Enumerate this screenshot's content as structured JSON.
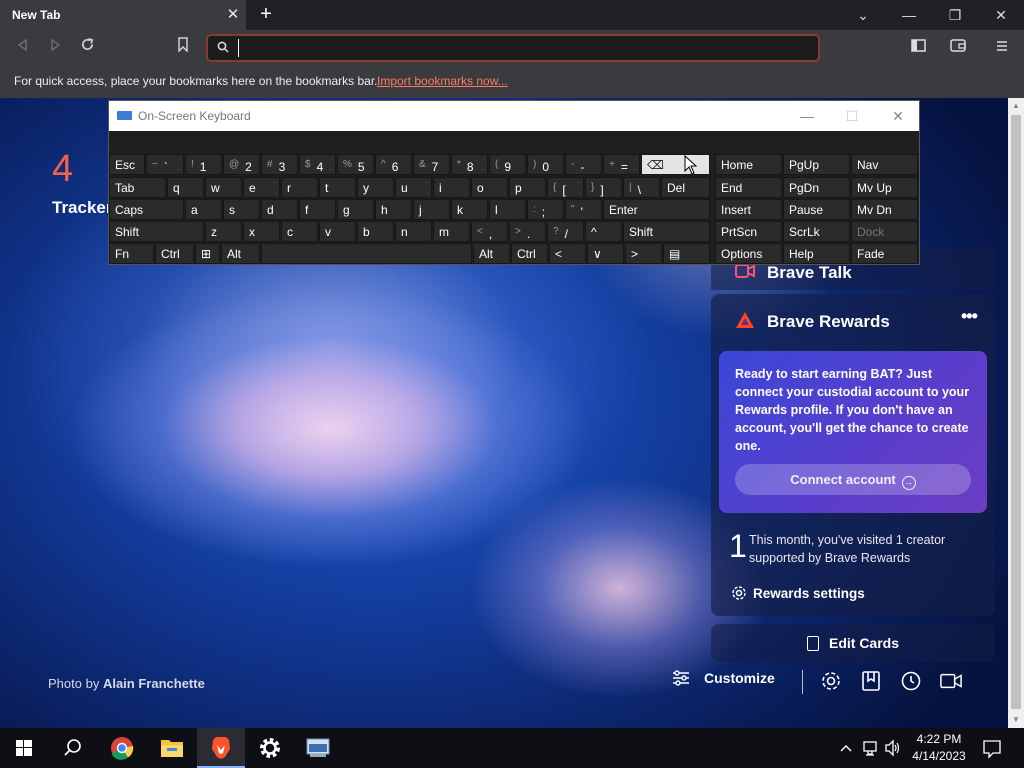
{
  "browser": {
    "tab_title": "New Tab",
    "tab_close_glyph": "✕",
    "new_tab_glyph": "+",
    "window_controls": {
      "list": "⌄",
      "minimize": "—",
      "maximize": "❐",
      "close": "✕"
    },
    "toolbar": {
      "back_icon": "back-arrow-icon",
      "forward_icon": "forward-arrow-icon",
      "reload_icon": "reload-icon",
      "bookmark_icon": "bookmark-icon",
      "address_value": "",
      "address_placeholder": "",
      "sidebar_icon": "sidebar-icon",
      "wallet_icon": "wallet-icon",
      "menu_icon": "menu-icon"
    },
    "bookmarks_bar": {
      "message": "For quick access, place your bookmarks here on the bookmarks bar.",
      "import_link": "Import bookmarks now..."
    }
  },
  "newtab": {
    "trackers_count": "4",
    "trackers_label": "Tracker",
    "photo_credit_prefix": "Photo by",
    "photo_credit_name": "Alain Franchette",
    "brave_talk": {
      "title": "Brave Talk"
    },
    "brave_rewards": {
      "title": "Brave Rewards",
      "more_glyph": "•••",
      "promo_text": "Ready to start earning BAT? Just connect your custodial account to your Rewards profile. If you don't have an account, you'll get the chance to create one.",
      "connect_button": "Connect account",
      "connect_arrow": "→",
      "visit_count": "1",
      "visit_text": "This month, you've visited 1 creator supported by Brave Rewards",
      "settings_label": "Rewards settings"
    },
    "edit_cards_label": "Edit Cards",
    "customize_label": "Customize"
  },
  "osk": {
    "title": "On-Screen Keyboard",
    "controls": {
      "minimize": "—",
      "maximize": "☐",
      "close": "✕"
    },
    "rows": [
      [
        {
          "id": "esc",
          "main": "Esc"
        },
        {
          "id": "tilde",
          "shift": "~",
          "main": "`"
        },
        {
          "id": "k1",
          "shift": "!",
          "main": "1"
        },
        {
          "id": "k2",
          "shift": "@",
          "main": "2"
        },
        {
          "id": "k3",
          "shift": "#",
          "main": "3"
        },
        {
          "id": "k4",
          "shift": "$",
          "main": "4"
        },
        {
          "id": "k5",
          "shift": "%",
          "main": "5"
        },
        {
          "id": "k6",
          "shift": "^",
          "main": "6"
        },
        {
          "id": "k7",
          "shift": "&",
          "main": "7"
        },
        {
          "id": "k8",
          "shift": "*",
          "main": "8"
        },
        {
          "id": "k9",
          "shift": "(",
          "main": "9"
        },
        {
          "id": "k0",
          "shift": ")",
          "main": "0"
        },
        {
          "id": "minus",
          "shift": "-",
          "main": "-"
        },
        {
          "id": "equals",
          "shift": "+",
          "main": "="
        },
        {
          "id": "backspace",
          "main": "⌫"
        },
        {
          "id": "home",
          "main": "Home"
        },
        {
          "id": "pgup",
          "main": "PgUp"
        },
        {
          "id": "nav",
          "main": "Nav"
        }
      ],
      [
        {
          "id": "tab",
          "main": "Tab"
        },
        {
          "id": "q",
          "main": "q"
        },
        {
          "id": "w",
          "main": "w"
        },
        {
          "id": "e",
          "main": "e"
        },
        {
          "id": "r",
          "main": "r"
        },
        {
          "id": "t",
          "main": "t"
        },
        {
          "id": "y",
          "main": "y"
        },
        {
          "id": "u",
          "main": "u"
        },
        {
          "id": "i",
          "main": "i"
        },
        {
          "id": "o",
          "main": "o"
        },
        {
          "id": "p",
          "main": "p"
        },
        {
          "id": "lbracket",
          "shift": "{",
          "main": "["
        },
        {
          "id": "rbracket",
          "shift": "}",
          "main": "]"
        },
        {
          "id": "backslash",
          "shift": "|",
          "main": "\\"
        },
        {
          "id": "del",
          "main": "Del"
        },
        {
          "id": "end",
          "main": "End"
        },
        {
          "id": "pgdn",
          "main": "PgDn"
        },
        {
          "id": "mvup",
          "main": "Mv Up"
        }
      ],
      [
        {
          "id": "caps",
          "main": "Caps"
        },
        {
          "id": "a",
          "main": "a"
        },
        {
          "id": "s",
          "main": "s"
        },
        {
          "id": "d",
          "main": "d"
        },
        {
          "id": "f",
          "main": "f"
        },
        {
          "id": "g",
          "main": "g"
        },
        {
          "id": "h",
          "main": "h"
        },
        {
          "id": "j",
          "main": "j"
        },
        {
          "id": "k",
          "main": "k"
        },
        {
          "id": "l",
          "main": "l"
        },
        {
          "id": "semicolon",
          "shift": ":",
          "main": ";"
        },
        {
          "id": "quote",
          "shift": "\"",
          "main": "'"
        },
        {
          "id": "enter",
          "main": "Enter"
        },
        {
          "id": "insert",
          "main": "Insert"
        },
        {
          "id": "pause",
          "main": "Pause"
        },
        {
          "id": "mvdn",
          "main": "Mv Dn"
        }
      ],
      [
        {
          "id": "lshift",
          "main": "Shift"
        },
        {
          "id": "z",
          "main": "z"
        },
        {
          "id": "x",
          "main": "x"
        },
        {
          "id": "c",
          "main": "c"
        },
        {
          "id": "v",
          "main": "v"
        },
        {
          "id": "b",
          "main": "b"
        },
        {
          "id": "n",
          "main": "n"
        },
        {
          "id": "m",
          "main": "m"
        },
        {
          "id": "comma",
          "shift": "<",
          "main": ","
        },
        {
          "id": "period",
          "shift": ">",
          "main": "."
        },
        {
          "id": "slash",
          "shift": "?",
          "main": "/"
        },
        {
          "id": "up",
          "main": "^"
        },
        {
          "id": "rshift",
          "main": "Shift"
        },
        {
          "id": "prtscn",
          "main": "PrtScn"
        },
        {
          "id": "scrlk",
          "main": "ScrLk"
        },
        {
          "id": "dock",
          "main": "Dock"
        }
      ],
      [
        {
          "id": "fn",
          "main": "Fn"
        },
        {
          "id": "lctrl",
          "main": "Ctrl"
        },
        {
          "id": "win",
          "main": "⊞"
        },
        {
          "id": "lalt",
          "main": "Alt"
        },
        {
          "id": "space",
          "main": ""
        },
        {
          "id": "ralt",
          "main": "Alt"
        },
        {
          "id": "rctrl",
          "main": "Ctrl"
        },
        {
          "id": "left",
          "main": "<"
        },
        {
          "id": "down",
          "main": "∨"
        },
        {
          "id": "right",
          "main": ">"
        },
        {
          "id": "menukey",
          "main": "▤"
        },
        {
          "id": "options",
          "main": "Options"
        },
        {
          "id": "help",
          "main": "Help"
        },
        {
          "id": "fade",
          "main": "Fade"
        }
      ]
    ]
  },
  "taskbar": {
    "apps": [
      {
        "name": "start-button",
        "icon": "windows-logo-icon"
      },
      {
        "name": "search-button",
        "icon": "search-icon"
      },
      {
        "name": "chrome-app",
        "icon": "chrome-icon"
      },
      {
        "name": "file-explorer-app",
        "icon": "folder-icon"
      },
      {
        "name": "brave-app",
        "icon": "brave-lion-icon",
        "active": true
      },
      {
        "name": "settings-app",
        "icon": "gear-icon"
      },
      {
        "name": "osk-app",
        "icon": "keyboard-icon"
      }
    ],
    "clock_time": "4:22 PM",
    "clock_date": "4/14/2023"
  },
  "colors": {
    "accent_orange": "#f0634a",
    "link_orange": "#ff7b5e",
    "rewards_gradient_start": "#3b47d8",
    "rewards_gradient_end": "#6b3dc2",
    "brave_orange": "#fb542b"
  }
}
